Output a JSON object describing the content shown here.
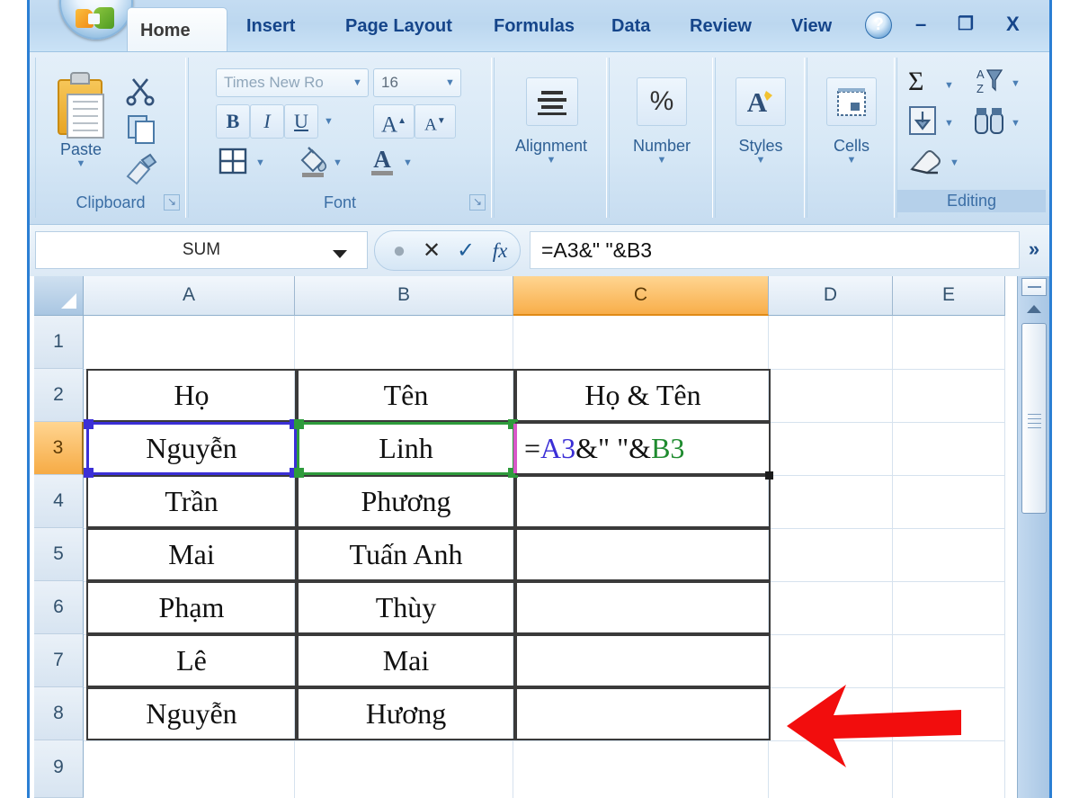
{
  "app": {
    "office_button": "office-orb",
    "window_controls": {
      "minimize": "–",
      "restore": "❐",
      "close": "X",
      "help": "?"
    }
  },
  "ribbon": {
    "tabs": [
      {
        "label": "Home",
        "active": true
      },
      {
        "label": "Insert",
        "active": false
      },
      {
        "label": "Page Layout",
        "active": false
      },
      {
        "label": "Formulas",
        "active": false
      },
      {
        "label": "Data",
        "active": false
      },
      {
        "label": "Review",
        "active": false
      },
      {
        "label": "View",
        "active": false
      }
    ],
    "groups": [
      {
        "label": "Clipboard",
        "has_launcher": true
      },
      {
        "label": "Font",
        "has_launcher": true
      },
      {
        "label": "Alignment",
        "has_launcher": false
      },
      {
        "label": "Number",
        "has_launcher": false
      },
      {
        "label": "Styles",
        "has_launcher": false
      },
      {
        "label": "Cells",
        "has_launcher": false
      },
      {
        "label": "Editing",
        "has_launcher": false
      }
    ],
    "clipboard": {
      "paste_label": "Paste",
      "cut_icon": "scissors-icon",
      "copy_icon": "copy-icon",
      "format_painter_icon": "format-painter-icon"
    },
    "font": {
      "font_name": "Times New Ro",
      "font_size": "16",
      "bold": "B",
      "italic": "I",
      "underline": "U",
      "grow_font": "A",
      "shrink_font": "A",
      "borders_icon": "borders-icon",
      "fill_color_icon": "fill-color-icon",
      "font_color_icon": "font-color-icon"
    },
    "alignment": {
      "label": "Alignment",
      "icon": "align-icon"
    },
    "number": {
      "label": "Number",
      "icon": "percent-icon",
      "glyph": "%"
    },
    "styles": {
      "label": "Styles",
      "icon": "styles-icon",
      "glyph": "A"
    },
    "cells": {
      "label": "Cells",
      "icon": "cells-icon"
    },
    "editing": {
      "label": "Editing",
      "autosum_glyph": "Σ",
      "autosum_icon": "autosum-icon",
      "sort_filter_icon": "sort-filter-icon",
      "fill_icon": "fill-down-icon",
      "find_select_icon": "find-select-icon",
      "clear_icon": "clear-eraser-icon"
    }
  },
  "formula_bar": {
    "name_box": "SUM",
    "cancel_icon": "cancel-x-icon",
    "enter_icon": "enter-check-icon",
    "insert_function_icon": "insert-function-icon",
    "insert_function_glyph": "fx",
    "formula": "=A3&\" \"&B3",
    "expand_glyph": "»"
  },
  "sheet": {
    "columns": [
      "A",
      "B",
      "C",
      "D",
      "E"
    ],
    "selected_column": "C",
    "rows": [
      "1",
      "2",
      "3",
      "4",
      "5",
      "6",
      "7",
      "8",
      "9"
    ],
    "selected_row": "3",
    "active_cell_ref": "C3",
    "cells": {
      "A2": "Họ",
      "B2": "Tên",
      "C2": "Họ & Tên",
      "A3": "Nguyễn",
      "B3": "Linh",
      "A4": "Trần",
      "B4": "Phương",
      "A5": "Mai",
      "B5": "Tuấn Anh",
      "A6": "Phạm",
      "B6": "Thùy",
      "A7": "Lê",
      "B7": "Mai",
      "A8": "Nguyễn",
      "B8": "Hương"
    },
    "active_cell_formula": {
      "parts": [
        {
          "text": "=",
          "color": "#111111"
        },
        {
          "text": "A3",
          "color": "#3b2fd6"
        },
        {
          "text": "&\" \"&",
          "color": "#111111"
        },
        {
          "text": "B3",
          "color": "#1f8b2f"
        }
      ]
    },
    "reference_highlights": [
      {
        "ref": "A3",
        "color": "#3b2fd6"
      },
      {
        "ref": "B3",
        "color": "#2e9b3c"
      }
    ]
  },
  "annotation": {
    "arrow": "red-pointer-arrow",
    "color": "#f20d0d",
    "points_to": "C3"
  },
  "scrollbar": {
    "vertical": "vertical-scrollbar",
    "split_box": "split-box",
    "up_arrow": "scroll-up-arrow",
    "thumb": "scroll-thumb"
  },
  "colors": {
    "accent": "#2b7fd4",
    "selection_orange": "#f8ae4a",
    "ref_blue": "#3b2fd6",
    "ref_green": "#2e9b3c",
    "arrow_red": "#f20d0d"
  }
}
